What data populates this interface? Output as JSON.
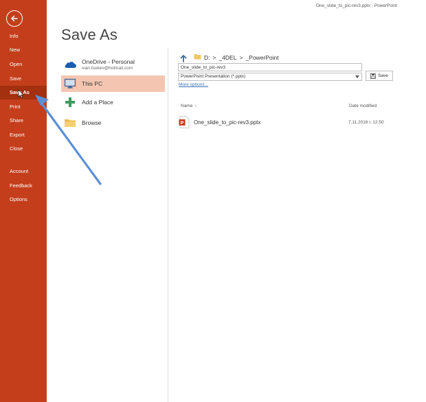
{
  "window": {
    "caption": "One_slide_to_pic-rev3.pptx  -  PowerPoint"
  },
  "rail": {
    "items": [
      {
        "label": "Info"
      },
      {
        "label": "New"
      },
      {
        "label": "Open"
      },
      {
        "label": "Save"
      },
      {
        "label": "Save As"
      },
      {
        "label": "Print"
      },
      {
        "label": "Share"
      },
      {
        "label": "Export"
      },
      {
        "label": "Close"
      },
      {
        "label": "Account"
      },
      {
        "label": "Feedback"
      },
      {
        "label": "Options"
      }
    ],
    "active": "Save As"
  },
  "page": {
    "title": "Save As"
  },
  "locations": [
    {
      "label": "OneDrive - Personal",
      "sub": "ivan.tsukev@hotmail.com",
      "icon": "onedrive-cloud-icon"
    },
    {
      "label": "This PC",
      "icon": "monitor-icon"
    },
    {
      "label": "Add a Place",
      "icon": "plus-icon"
    },
    {
      "label": "Browse",
      "icon": "folder-icon"
    }
  ],
  "right": {
    "breadcrumb": [
      "D:",
      ">",
      "_4DEL",
      ">",
      "_PowerPoint"
    ],
    "filename_value": "One_slide_to_pic-rev3",
    "filetype_value": "PowerPoint Presentation (*.pptx)",
    "more_options": "More options...",
    "save_label": "Save",
    "col_name": "Name",
    "col_name_sort": "↑",
    "col_date": "Date modified",
    "files": [
      {
        "name": "One_slide_to_pic-rev3.pptx",
        "date": "7.11.2016 г. 12:50"
      }
    ]
  },
  "colors": {
    "accent": "#c43e1c",
    "rail_active": "#a3300f",
    "selected_location": "#f4c6b2",
    "annotation_arrow": "#5b8fd4"
  }
}
